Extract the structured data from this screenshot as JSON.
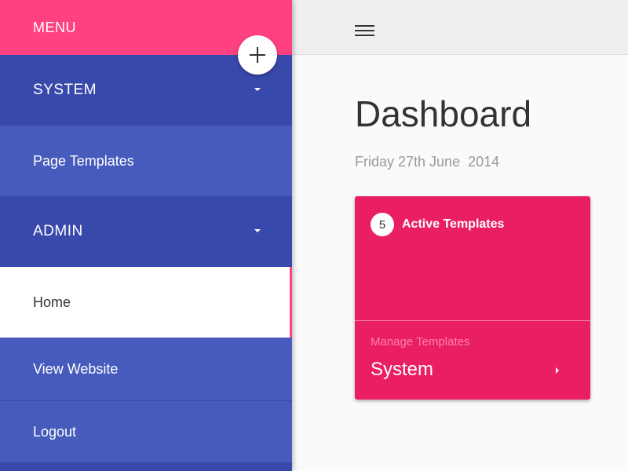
{
  "sidebar": {
    "menu_label": "MENU",
    "items": [
      {
        "label": "SYSTEM",
        "type": "section"
      },
      {
        "label": "Page Templates"
      },
      {
        "label": "ADMIN",
        "type": "section"
      },
      {
        "label": "Home",
        "active": true
      },
      {
        "label": "View Website"
      },
      {
        "label": "Logout"
      }
    ]
  },
  "fab": {
    "icon": "plus-icon"
  },
  "topbar": {
    "icon": "hamburger-menu-icon"
  },
  "main": {
    "title": "Dashboard",
    "date": "Friday 27th June  2014",
    "card": {
      "count": "5",
      "title": "Active Templates",
      "subtitle": "Manage Templates",
      "link": "System"
    }
  },
  "colors": {
    "accent": "#ff4081",
    "primary": "#3949ab",
    "card": "#e91e63"
  }
}
